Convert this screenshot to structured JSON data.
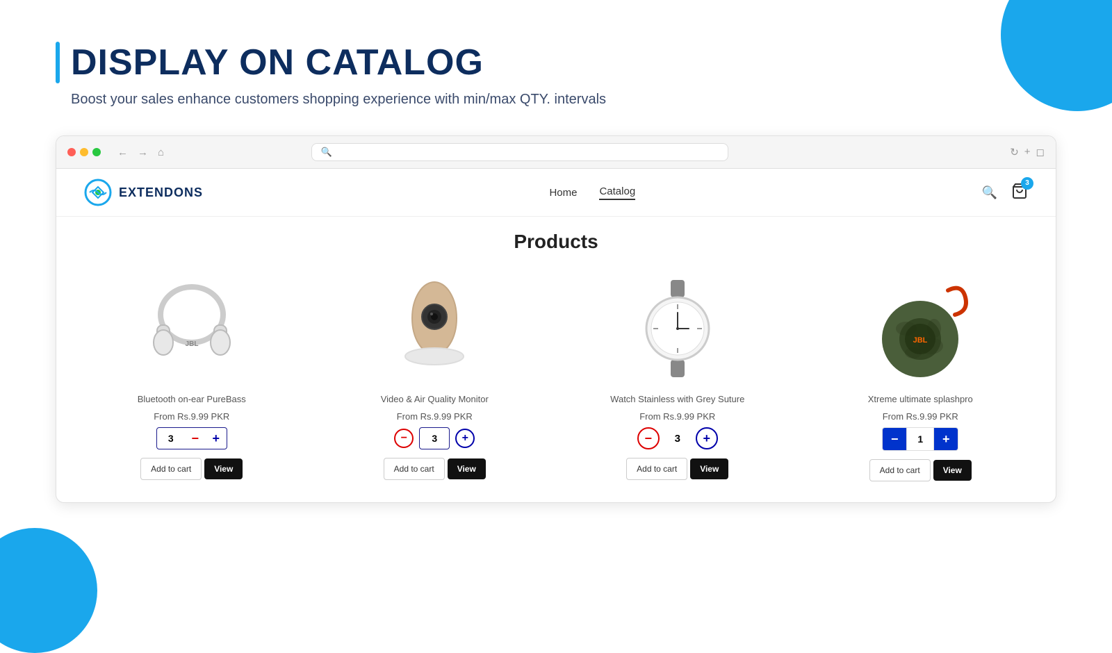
{
  "page": {
    "title": "DISPLAY ON CATALOG",
    "subtitle": "Boost your sales enhance customers shopping experience with min/max QTY. intervals"
  },
  "browser": {
    "search_placeholder": ""
  },
  "store": {
    "logo_text": "EXTENDONS",
    "nav_items": [
      "Home",
      "Catalog"
    ],
    "active_nav": "Catalog",
    "cart_count": "3"
  },
  "products_section": {
    "title": "Products",
    "products": [
      {
        "id": 1,
        "name": "Bluetooth on-ear PureBass",
        "price": "From Rs.9.99 PKR",
        "qty": "3",
        "stepper_type": "outline",
        "color": "grey"
      },
      {
        "id": 2,
        "name": "Video & Air Quality Monitor",
        "price": "From Rs.9.99 PKR",
        "qty": "3",
        "stepper_type": "circle",
        "color": "blue"
      },
      {
        "id": 3,
        "name": "Watch Stainless with Grey Suture",
        "price": "From Rs.9.99 PKR",
        "qty": "3",
        "stepper_type": "circle-red",
        "color": "grey"
      },
      {
        "id": 4,
        "name": "Xtreme ultimate splashpro",
        "price": "From Rs.9.99 PKR",
        "qty": "1",
        "stepper_type": "filled",
        "color": "blue"
      }
    ]
  },
  "buttons": {
    "add_to_cart": "Add to cart",
    "view": "View"
  }
}
